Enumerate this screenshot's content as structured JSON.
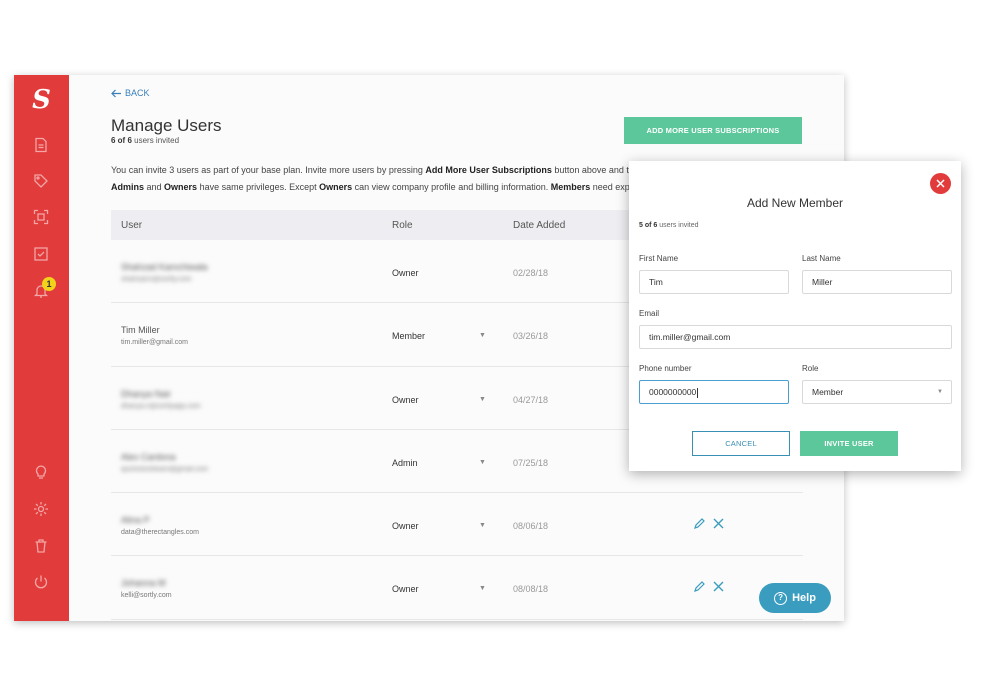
{
  "brand": {
    "logo": "S",
    "accent": "#e23b3b",
    "green": "#5cc79b"
  },
  "sidebar": {
    "notification_count": "1",
    "icons": [
      "document-icon",
      "tag-icon",
      "scan-icon",
      "checklist-icon",
      "bell-icon",
      "lightbulb-icon",
      "gear-icon",
      "trash-icon",
      "power-icon"
    ]
  },
  "header": {
    "back_label": "BACK",
    "title": "Manage Users",
    "count_bold": "6 of 6",
    "count_rest": " users invited",
    "add_subscriptions": "ADD MORE USER SUBSCRIPTIONS"
  },
  "info": {
    "line1_a": "You can invite 3 users as part of your base plan. Invite more users by pressing ",
    "line1_b": "Add More User Subscriptions",
    "line1_c": " button above and th",
    "line2_a": "Admins",
    "line2_b": " and ",
    "line2_c": "Owners",
    "line2_d": " have same privileges. Except ",
    "line2_e": "Owners",
    "line2_f": " can view company profile and billing information. ",
    "line2_g": "Members",
    "line2_h": " need explic"
  },
  "table": {
    "headers": {
      "user": "User",
      "role": "Role",
      "date": "Date Added"
    },
    "rows": [
      {
        "name": "Shahzad Kamchiwala",
        "email": "shahzad.k@sortly.com",
        "role": "Owner",
        "date": "02/28/18",
        "blur_name": true,
        "blur_email": true,
        "has_caret": false,
        "has_actions": false
      },
      {
        "name": "Tim Miller",
        "email": "tim.miller@gmail.com",
        "role": "Member",
        "date": "03/26/18",
        "blur_name": false,
        "blur_email": false,
        "has_caret": true,
        "has_actions": false
      },
      {
        "name": "Dhanya Nair",
        "email": "dhanya.n@sortlyapp.com",
        "role": "Owner",
        "date": "04/27/18",
        "blur_name": true,
        "blur_email": true,
        "has_caret": true,
        "has_actions": false
      },
      {
        "name": "Alex Cardona",
        "email": "quickstockteam@gmail.com",
        "role": "Admin",
        "date": "07/25/18",
        "blur_name": true,
        "blur_email": true,
        "has_caret": true,
        "has_actions": false
      },
      {
        "name": "Alina P",
        "email": "data@therectangles.com",
        "role": "Owner",
        "date": "08/06/18",
        "blur_name": true,
        "blur_email": false,
        "has_caret": true,
        "has_actions": true
      },
      {
        "name": "Johanna M",
        "email": "kelli@sortly.com",
        "role": "Owner",
        "date": "08/08/18",
        "blur_name": true,
        "blur_email": false,
        "has_caret": true,
        "has_actions": true
      }
    ]
  },
  "help": {
    "label": "Help",
    "glyph": "?"
  },
  "modal": {
    "title": "Add New Member",
    "count_bold": "5 of 6",
    "count_rest": " users invited",
    "first_name_label": "First Name",
    "first_name_value": "Tim",
    "last_name_label": "Last Name",
    "last_name_value": "Miller",
    "email_label": "Email",
    "email_value": "tim.miller@gmail.com",
    "phone_label": "Phone number",
    "phone_value": "0000000000",
    "role_label": "Role",
    "role_value": "Member",
    "cancel_label": "CANCEL",
    "invite_label": "INVITE USER"
  }
}
